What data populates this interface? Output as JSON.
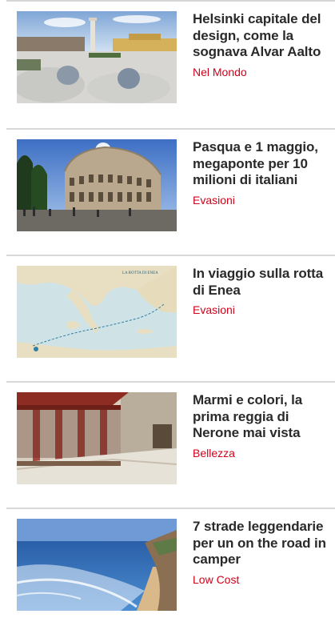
{
  "articles": [
    {
      "title": "Helsinki capitale del design, come la sognava Alvar Aalto",
      "category": "Nel Mondo",
      "image": "helsinki-square-photo"
    },
    {
      "title": "Pasqua e 1 maggio, megaponte per 10 milioni di italiani",
      "category": "Evasioni",
      "image": "colosseum-photo"
    },
    {
      "title": "In viaggio sulla rotta di Enea",
      "category": "Evasioni",
      "image": "mediterranean-map-image",
      "map_caption": "LA ROTTA DI ENEA"
    },
    {
      "title": "Marmi e colori, la prima reggia di Nerone mai vista",
      "category": "Bellezza",
      "image": "roman-palace-reconstruction-image"
    },
    {
      "title": "7 strade leggendarie per un on the road in camper",
      "category": "Low Cost",
      "image": "coastal-road-photo"
    }
  ],
  "colors": {
    "title": "#2a2a2a",
    "category": "#d0021b",
    "divider": "#d8d8d8"
  }
}
